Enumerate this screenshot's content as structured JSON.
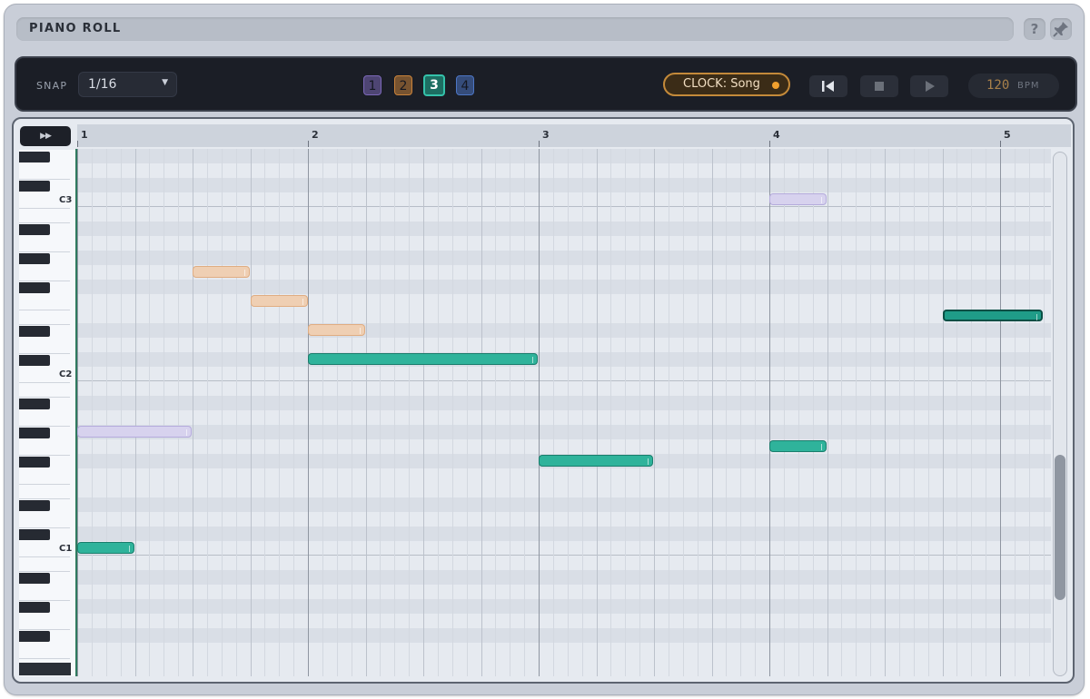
{
  "window": {
    "title": "PIANO ROLL",
    "help_label": "?"
  },
  "toolbar": {
    "snap_label": "SNAP",
    "snap_value": "1/16",
    "patterns": [
      {
        "label": "1",
        "color": "#7b67b8",
        "selected": false
      },
      {
        "label": "2",
        "color": "#c9823a",
        "selected": false
      },
      {
        "label": "3",
        "color": "#34c2aa",
        "selected": true
      },
      {
        "label": "4",
        "color": "#4c75c4",
        "selected": false
      }
    ],
    "clock_label": "CLOCK: Song",
    "bpm_value": "120",
    "bpm_unit": "BPM"
  },
  "ruler": {
    "bars": [
      "1",
      "2",
      "3",
      "4",
      "5"
    ]
  },
  "keyboard": {
    "octave_labels": [
      "C3",
      "C2",
      "C1"
    ]
  },
  "notes": [
    {
      "bar": 1.0,
      "length_beats": 1,
      "pitch": "C1",
      "color": "green"
    },
    {
      "bar": 1.0,
      "length_beats": 2,
      "pitch": "G#1",
      "color": "purple"
    },
    {
      "bar": 1.5,
      "length_beats": 1,
      "pitch": "G2",
      "color": "orange"
    },
    {
      "bar": 1.75,
      "length_beats": 1,
      "pitch": "F2",
      "color": "orange"
    },
    {
      "bar": 2.0,
      "length_beats": 1,
      "pitch": "D#2",
      "color": "orange"
    },
    {
      "bar": 2.0,
      "length_beats": 4,
      "pitch": "C#2",
      "color": "green"
    },
    {
      "bar": 3.0,
      "length_beats": 2,
      "pitch": "F#1",
      "color": "green"
    },
    {
      "bar": 4.0,
      "length_beats": 1,
      "pitch": "C3",
      "color": "purple"
    },
    {
      "bar": 4.0,
      "length_beats": 1,
      "pitch": "G1",
      "color": "green"
    },
    {
      "bar": 4.75,
      "length_beats": 1.75,
      "pitch": "E2",
      "color": "green",
      "selected": true
    }
  ],
  "colors": {
    "accent": "#34c2aa",
    "clock_dot": "#f0a02e",
    "note_green": "#2fb39b",
    "note_orange": "#efcfb3",
    "note_purple": "#d7d2ee"
  }
}
